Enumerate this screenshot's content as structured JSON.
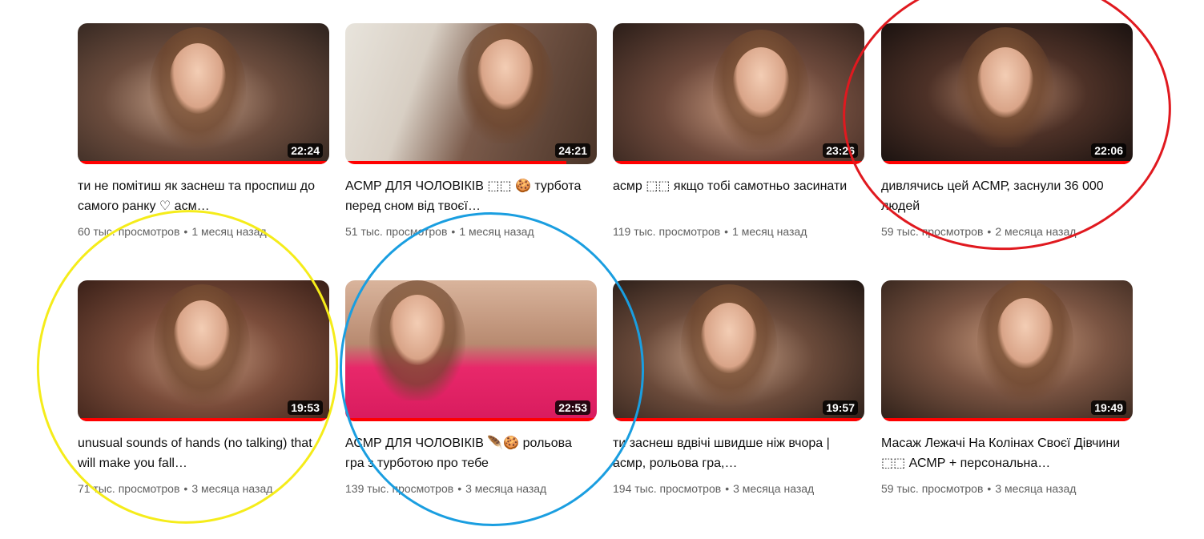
{
  "videos": [
    {
      "title": "ти не помітиш як заснеш та проспиш до самого ранку ♡ асм…",
      "views": "60 тыс. просмотров",
      "age": "1 месяц назад",
      "duration": "22:24"
    },
    {
      "title": "АСМР ДЛЯ ЧОЛОВІКІВ ⬚⬚ 🍪 турбота перед сном від твоєї…",
      "views": "51 тыс. просмотров",
      "age": "1 месяц назад",
      "duration": "24:21"
    },
    {
      "title": "асмр ⬚⬚ якщо тобі самотньо засинати",
      "views": "119 тыс. просмотров",
      "age": "1 месяц назад",
      "duration": "23:26"
    },
    {
      "title": "дивлячись цей АСМР, заснули 36 000 людей",
      "views": "59 тыс. просмотров",
      "age": "2 месяца назад",
      "duration": "22:06"
    },
    {
      "title": "unusual sounds of hands (no talking) that will make you fall…",
      "views": "71 тыс. просмотров",
      "age": "3 месяца назад",
      "duration": "19:53"
    },
    {
      "title": "АСМР ДЛЯ ЧОЛОВІКІВ 🪶🍪 рольова гра з турботою про тебе",
      "views": "139 тыс. просмотров",
      "age": "3 месяца назад",
      "duration": "22:53"
    },
    {
      "title": "ти заснеш вдвічі швидше ніж вчора | асмр, рольова гра,…",
      "views": "194 тыс. просмотров",
      "age": "3 месяца назад",
      "duration": "19:57"
    },
    {
      "title": "Масаж Лежачі На Колінах Своєї Дівчини ⬚⬚ АСМР + персональна…",
      "views": "59 тыс. просмотров",
      "age": "3 месяца назад",
      "duration": "19:49"
    }
  ],
  "annotations": {
    "red_circle_color": "#e0191f",
    "yellow_circle_color": "#f5ec1a",
    "blue_circle_color": "#1a9ee0"
  },
  "meta_separator": "•"
}
